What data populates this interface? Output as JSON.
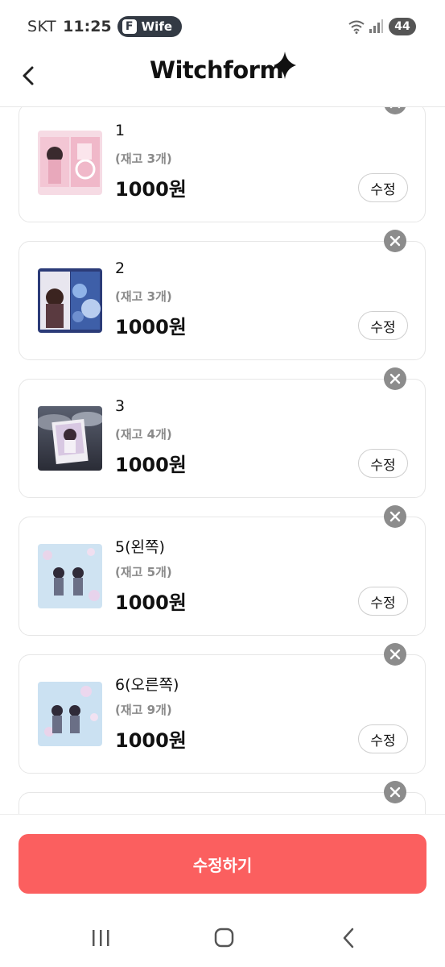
{
  "status_bar": {
    "carrier": "SKT",
    "time": "11:25",
    "app_pill_icon": "F",
    "app_pill_label": "Wife",
    "battery": "44",
    "icons": [
      "wifi-icon",
      "signal-icon",
      "battery-icon"
    ]
  },
  "header": {
    "brand": "Witchform",
    "back_icon": "chevron-left-icon"
  },
  "items": [
    {
      "name": "1",
      "stock": "(재고 3개)",
      "price": "1000원",
      "edit_label": "수정"
    },
    {
      "name": "2",
      "stock": "(재고 3개)",
      "price": "1000원",
      "edit_label": "수정"
    },
    {
      "name": "3",
      "stock": "(재고 4개)",
      "price": "1000원",
      "edit_label": "수정"
    },
    {
      "name": "5(왼쪽)",
      "stock": "(재고 5개)",
      "price": "1000원",
      "edit_label": "수정"
    },
    {
      "name": "6(오른쪽)",
      "stock": "(재고 9개)",
      "price": "1000원",
      "edit_label": "수정"
    }
  ],
  "submit_label": "수정하기",
  "colors": {
    "accent": "#fb5f5f",
    "remove_button": "#8c8c8c",
    "stock_text": "#8b8b8b"
  },
  "nav": [
    "recent-apps-icon",
    "home-icon",
    "back-icon"
  ]
}
